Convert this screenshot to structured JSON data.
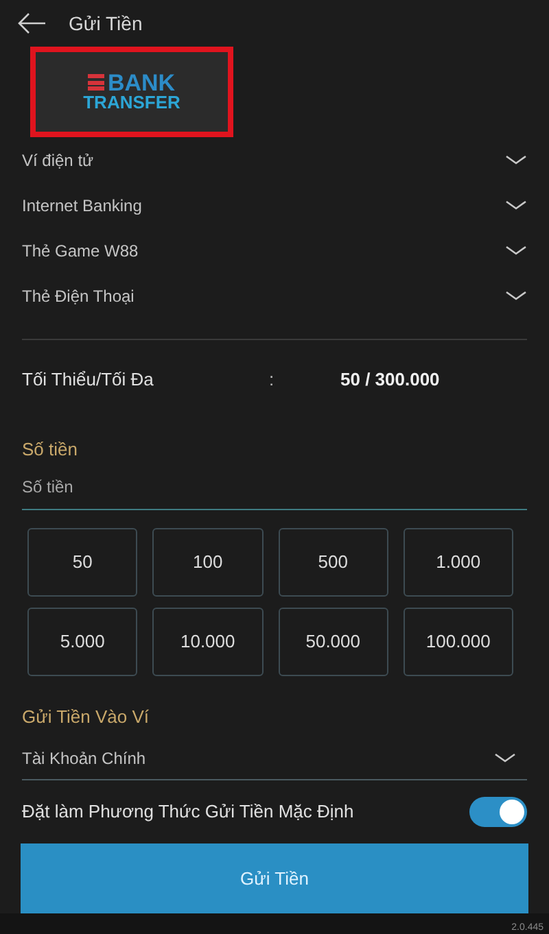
{
  "header": {
    "title": "Gửi Tiền"
  },
  "payment_methods": [
    {
      "label": "BANK",
      "label_2": "TRANSFER",
      "selected": true
    }
  ],
  "method_rows": [
    {
      "label": "Ví điện tử",
      "expanded": false
    },
    {
      "label": "Internet Banking",
      "expanded": false
    },
    {
      "label": "Thẻ Game W88",
      "expanded": false
    },
    {
      "label": "Thẻ Điện Thoại",
      "expanded": false
    }
  ],
  "limits": {
    "label": "Tối Thiểu/Tối Đa",
    "separator": ":",
    "value": "50 / 300.000"
  },
  "amount": {
    "label": "Số tiền",
    "placeholder": "Số tiền"
  },
  "quick_amounts": [
    "50",
    "100",
    "500",
    "1.000",
    "5.000",
    "10.000",
    "50.000",
    "100.000"
  ],
  "wallet": {
    "label": "Gửi Tiền Vào Ví",
    "value": "Tài Khoản Chính"
  },
  "default_toggle": {
    "label": "Đặt làm Phương Thức Gửi Tiền Mặc Định",
    "on": true
  },
  "submit": {
    "label": "Gửi Tiền"
  },
  "footer": {
    "version": "2.0.445"
  }
}
